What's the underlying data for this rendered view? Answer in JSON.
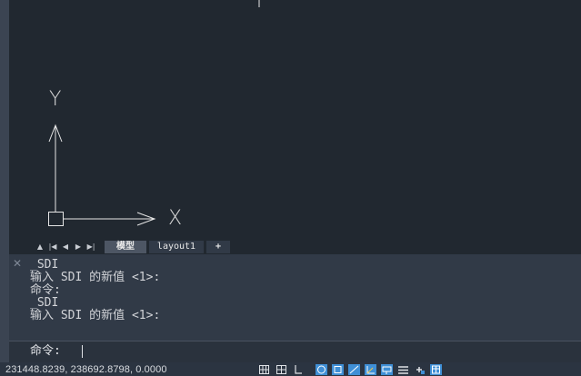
{
  "tabs": {
    "model_label": "模型",
    "layout1_label": "layout1",
    "add_label": "+"
  },
  "canvas": {
    "ucs_x_label": "X",
    "ucs_y_label": "Y"
  },
  "command_line": {
    "close_glyph": "✕",
    "history": [
      "_SDI",
      "输入 SDI 的新值 <1>:",
      "命令:",
      "_SDI",
      "输入 SDI 的新值 <1>:"
    ],
    "prompt": "命令:",
    "input_value": ""
  },
  "status_bar": {
    "coordinates": "231448.8239, 238692.8798, 0.0000",
    "toggles": [
      {
        "name": "grid-display-icon",
        "active": false
      },
      {
        "name": "snap-mode-icon",
        "active": false
      },
      {
        "name": "ortho-mode-icon",
        "active": false
      },
      {
        "name": "polar-tracking-icon",
        "active": true
      },
      {
        "name": "object-snap-icon",
        "active": true
      },
      {
        "name": "object-snap-tracking-icon",
        "active": true
      },
      {
        "name": "dynamic-ucs-icon",
        "active": true
      },
      {
        "name": "dynamic-input-icon",
        "active": true
      },
      {
        "name": "lineweight-icon",
        "active": false
      },
      {
        "name": "transparency-icon",
        "active": false
      },
      {
        "name": "selection-cycling-icon",
        "active": true
      }
    ]
  },
  "colors": {
    "canvas_bg": "#212830",
    "panel_bg": "#313a47",
    "active_icon": "#3f8fd6",
    "ucs_line": "#e6e6e6"
  }
}
